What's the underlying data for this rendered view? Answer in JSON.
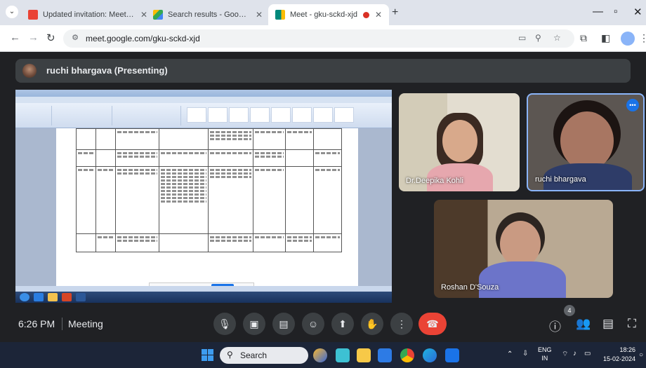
{
  "browser": {
    "tabs": [
      {
        "label": "Updated invitation: Meeting @",
        "favicon_color": "#ea4335"
      },
      {
        "label": "Search results - Google Drive",
        "favicon_color": "#fbbc04"
      },
      {
        "label": "Meet - gku-sckd-xjd",
        "favicon_color": "#00897b"
      }
    ],
    "new_tab": "+",
    "url": "meet.google.com/gku-sckd-xjd"
  },
  "meet": {
    "presenter_label": "ruchi bhargava (Presenting)",
    "participants": [
      {
        "name": "Dr.Deepika Kohli"
      },
      {
        "name": "ruchi bhargava"
      },
      {
        "name": "Roshan D'Souza"
      }
    ],
    "time": "6:26 PM",
    "meeting_title": "Meeting",
    "people_count": "4"
  },
  "taskbar": {
    "search_label": "Search",
    "lang_top": "ENG",
    "lang_bottom": "IN",
    "clock_time": "18:26",
    "clock_date": "15-02-2024"
  },
  "colors": {
    "meet_background": "#202124",
    "leave_button": "#ea4335",
    "active_speaker_border": "#8ab4f8",
    "accent": "#1a73e8"
  }
}
